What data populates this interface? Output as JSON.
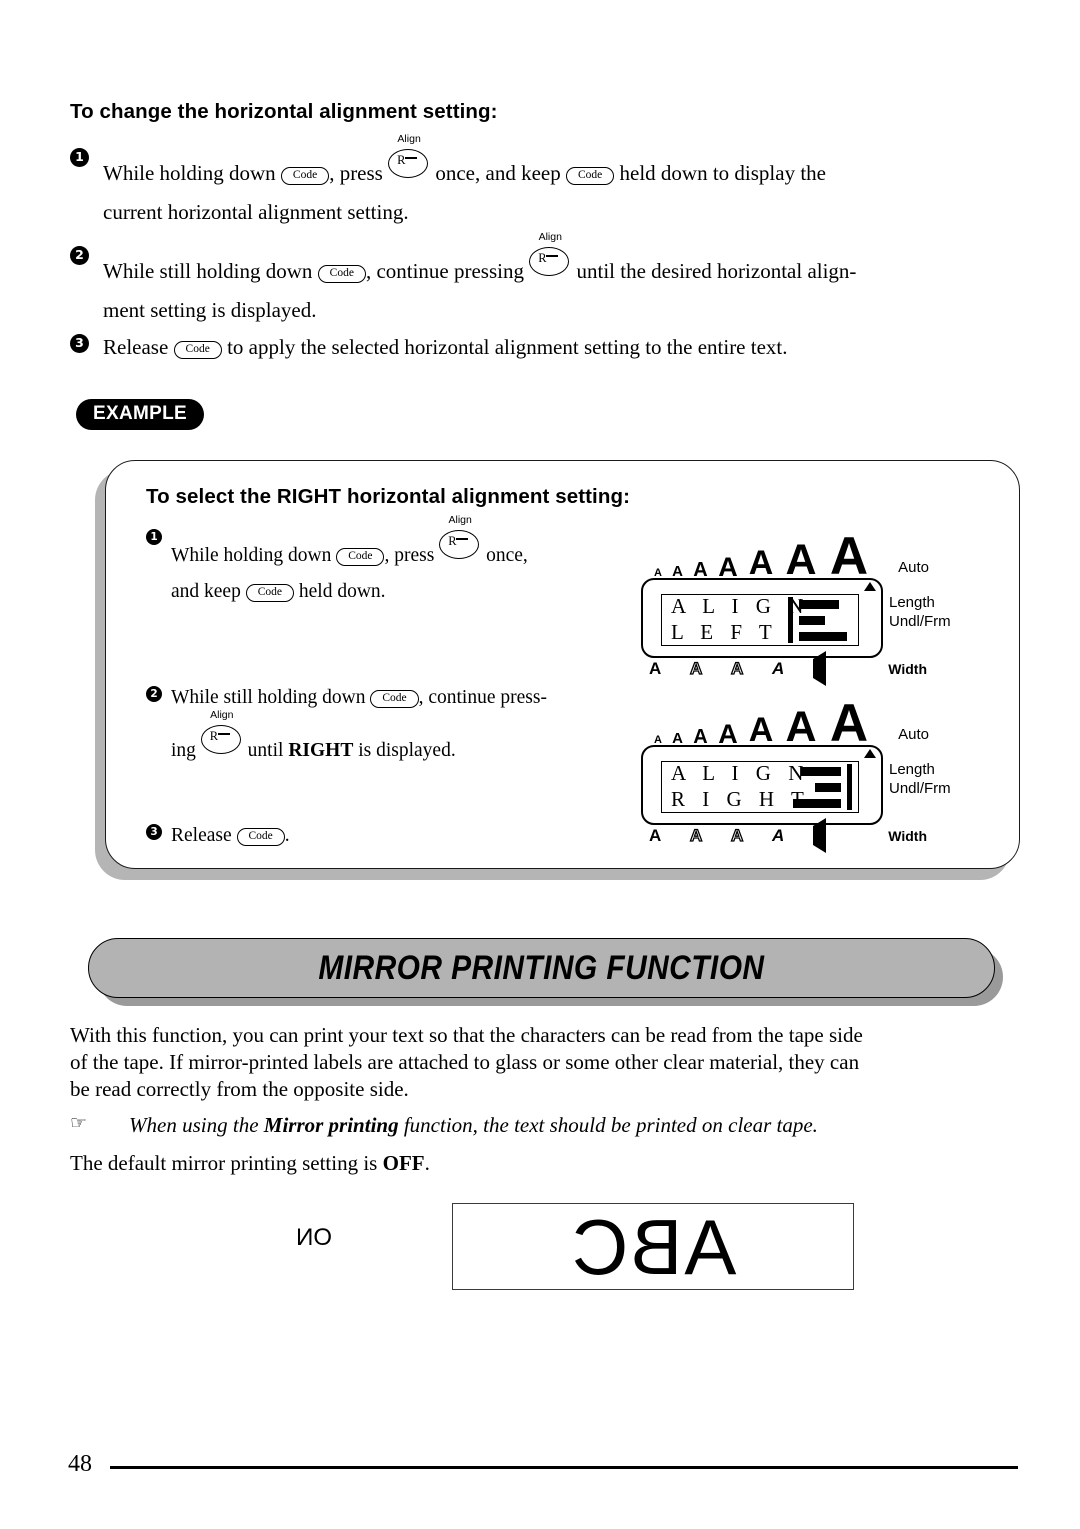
{
  "page": {
    "number": "48"
  },
  "section_a": {
    "heading": "To change the horizontal alignment setting:",
    "steps": [
      {
        "num": "❶",
        "part1": "While holding down",
        "key1": "Code",
        "part2": ", press",
        "key2_label": "Align",
        "key2": "R",
        "part3": "once, and keep",
        "key3": "Code",
        "part4": "held down to display the",
        "cont": "current horizontal alignment setting."
      },
      {
        "num": "❷",
        "part1": "While still holding down",
        "key1": "Code",
        "part2": ", continue pressing",
        "key2_label": "Align",
        "key2": "R",
        "part3": "until the desired horizontal align-",
        "cont": "ment setting is displayed."
      },
      {
        "num": "❸",
        "part1": "Release",
        "key1": "Code",
        "part2": "to apply the selected horizontal alignment setting to the entire text."
      }
    ]
  },
  "example": {
    "badge": "EXAMPLE",
    "heading": "To select the RIGHT horizontal alignment setting:",
    "steps": [
      {
        "num": "❶",
        "part1": "While  holding  down",
        "key1": "Code",
        "part2": ",  press",
        "key2_label": "Align",
        "key2": "R",
        "part3": "once,",
        "cont_pre": "and keep",
        "cont_key": "Code",
        "cont_post": "held down."
      },
      {
        "num": "❷",
        "part1": "While still holding down",
        "key1": "Code",
        "part2": ", continue press-",
        "cont_pre": "ing",
        "key2_label": "Align",
        "key2": "R",
        "cont_mid": "until",
        "cont_bold": "RIGHT",
        "cont_post": "is displayed."
      },
      {
        "num": "❸",
        "part1": "Release",
        "key1": "Code",
        "part2": "."
      }
    ],
    "displays": [
      {
        "line1": "A L I G N",
        "line2": "L E F T",
        "align": "left",
        "auto": "Auto",
        "length": "Length",
        "undl": "Undl/Frm",
        "width": "Width",
        "size_markers": [
          "A",
          "A",
          "A",
          "A",
          "A",
          "A",
          "A"
        ],
        "style_markers": [
          "A",
          "A",
          "A",
          "A"
        ]
      },
      {
        "line1": "A L I G N",
        "line2": "R I G H T",
        "align": "right",
        "auto": "Auto",
        "length": "Length",
        "undl": "Undl/Frm",
        "width": "Width",
        "size_markers": [
          "A",
          "A",
          "A",
          "A",
          "A",
          "A",
          "A"
        ],
        "style_markers": [
          "A",
          "A",
          "A",
          "A"
        ]
      }
    ]
  },
  "section_b": {
    "banner_title": "MIRROR PRINTING FUNCTION",
    "paragraph_lines": [
      "With this function, you can print your text so that the characters can be read from the tape side",
      "of the tape. If mirror-printed labels are attached to glass or some other clear material, they can",
      "be read correctly from the opposite side."
    ],
    "note_icon": "☞",
    "note_pre": "When using the ",
    "note_bold": "Mirror printing",
    "note_post": " function, the text should be printed on clear tape.",
    "default_pre": "The default mirror printing setting is ",
    "default_bold": "OFF",
    "default_post": ".",
    "sample_label": "ON",
    "sample_text": "ABC"
  }
}
